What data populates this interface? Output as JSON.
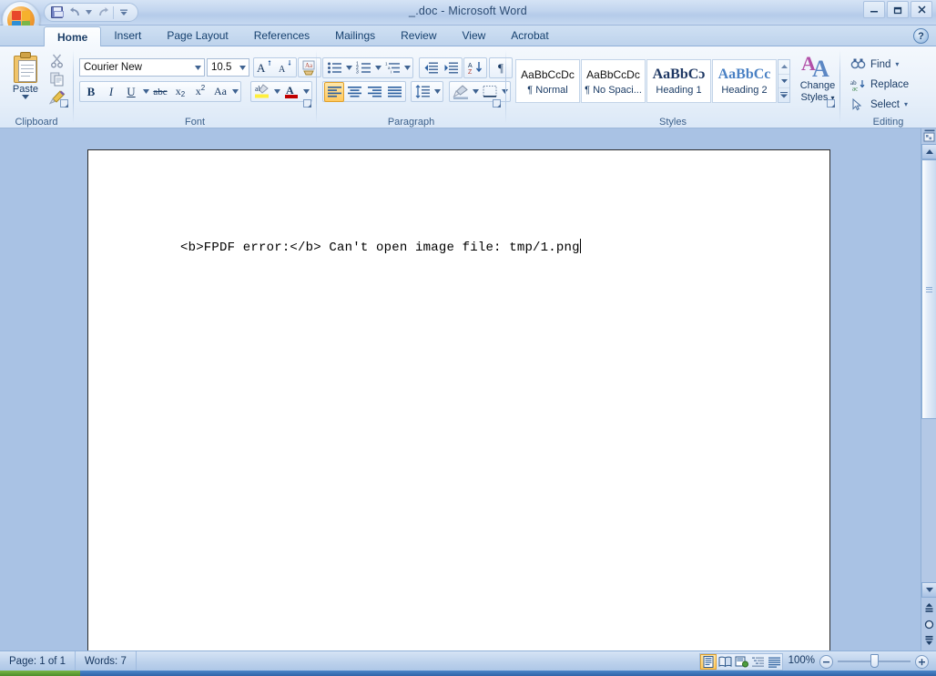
{
  "window": {
    "title": "_.doc - Microsoft Word",
    "minimize_label": "–",
    "restore_label": "❐",
    "close_label": "✕"
  },
  "quick_access": {
    "save_tooltip": "Save",
    "undo_tooltip": "Undo",
    "redo_tooltip": "Redo",
    "customize_tooltip": "Customize Quick Access Toolbar"
  },
  "tabs": [
    {
      "label": "Home",
      "active": true
    },
    {
      "label": "Insert",
      "active": false
    },
    {
      "label": "Page Layout",
      "active": false
    },
    {
      "label": "References",
      "active": false
    },
    {
      "label": "Mailings",
      "active": false
    },
    {
      "label": "Review",
      "active": false
    },
    {
      "label": "View",
      "active": false
    },
    {
      "label": "Acrobat",
      "active": false
    }
  ],
  "help": {
    "label": "?"
  },
  "ribbon": {
    "groups": [
      {
        "name": "Clipboard",
        "label": "Clipboard"
      },
      {
        "name": "Font",
        "label": "Font"
      },
      {
        "name": "Paragraph",
        "label": "Paragraph"
      },
      {
        "name": "Styles",
        "label": "Styles"
      },
      {
        "name": "Editing",
        "label": "Editing"
      }
    ],
    "clipboard": {
      "paste_label": "Paste",
      "cut_tooltip": "Cut",
      "copy_tooltip": "Copy",
      "format_painter_tooltip": "Format Painter"
    },
    "font": {
      "font_name": "Courier New",
      "font_size": "10.5",
      "grow_font": "A",
      "shrink_font": "A",
      "clear_formatting": "Aa",
      "bold": "B",
      "italic": "I",
      "underline": "U",
      "strikethrough": "abc",
      "subscript": "x₂",
      "superscript": "x²",
      "change_case": "Aa",
      "highlight": "ab",
      "font_color": "A"
    },
    "paragraph": {
      "bullets": "•",
      "numbering": "1.",
      "multilevel": "1a",
      "decrease_indent": "←",
      "increase_indent": "→",
      "sort": "AZ↓",
      "show_marks": "¶",
      "align_left": "left",
      "align_center": "center",
      "align_right": "right",
      "justify": "justify",
      "line_spacing": "↕",
      "shading": "shade",
      "borders": "borders",
      "active_alignment": "align_left"
    },
    "styles": {
      "items": [
        {
          "preview": "AaBbCcDc",
          "name": "¶ Normal",
          "preview_style": "normal"
        },
        {
          "preview": "AaBbCcDc",
          "name": "¶ No Spaci...",
          "preview_style": "nospacing"
        },
        {
          "preview": "AaBbCɔ",
          "name": "Heading 1",
          "preview_style": "h1"
        },
        {
          "preview": "AaBbCc",
          "name": "Heading 2",
          "preview_style": "h2"
        }
      ],
      "change_styles_line1": "Change",
      "change_styles_line2": "Styles",
      "scroll_up": "▲",
      "scroll_down": "▼",
      "more": "≡"
    },
    "editing": {
      "find": "Find",
      "replace": "Replace",
      "select": "Select"
    }
  },
  "document": {
    "text": "<b>FPDF error:</b> Can't open image file: tmp/1.png",
    "cursor_visible": true
  },
  "scrollbar": {
    "ruler_toggle_tooltip": "View Ruler",
    "up_arrow": "▲",
    "down_arrow": "▼",
    "previous_page": "⤒",
    "select_browse_object": "●",
    "next_page": "⤓"
  },
  "statusbar": {
    "page": "Page: 1 of 1",
    "words": "Words: 7",
    "zoom": "100%",
    "zoom_out": "–",
    "zoom_in": "+",
    "views": [
      {
        "name": "print-layout",
        "active": true
      },
      {
        "name": "full-screen-reading",
        "active": false
      },
      {
        "name": "web-layout",
        "active": false
      },
      {
        "name": "outline",
        "active": false
      },
      {
        "name": "draft",
        "active": false
      }
    ]
  },
  "colors": {
    "accent": "#1b3c66",
    "workspace": "#a9c2e4",
    "active_highlight": "#ffc95e"
  }
}
